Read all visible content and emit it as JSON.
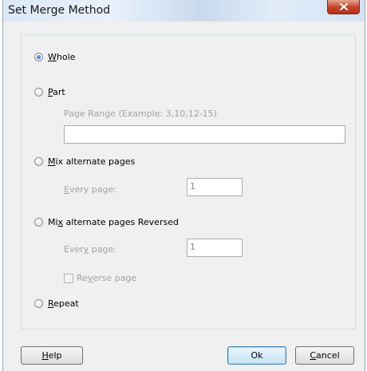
{
  "window": {
    "title": "Set Merge Method",
    "close_icon": "close-icon"
  },
  "options": {
    "whole": {
      "prefix": "",
      "accel": "W",
      "rest": "hole",
      "checked": true
    },
    "part": {
      "prefix": "",
      "accel": "P",
      "rest": "art",
      "checked": false,
      "range_label": "Page Range (Example: 3,10,12-15)",
      "range_value": ""
    },
    "mix": {
      "prefix": "",
      "accel": "M",
      "rest": "ix alternate pages",
      "checked": false,
      "every_prefix": "",
      "every_accel": "E",
      "every_rest": "very page:",
      "every_value": "1"
    },
    "mix_reversed": {
      "prefix": "Mi",
      "accel": "x",
      "rest": " alternate pages Reversed",
      "checked": false,
      "every_prefix": "Ever",
      "every_accel": "y",
      "every_rest": " page:",
      "every_value": "1",
      "reverse_prefix": "Re",
      "reverse_accel": "v",
      "reverse_rest": "erse page",
      "reverse_checked": false
    },
    "repeat": {
      "prefix": "",
      "accel": "R",
      "rest": "epeat",
      "checked": false
    }
  },
  "buttons": {
    "help": {
      "prefix": "",
      "accel": "H",
      "rest": "elp"
    },
    "ok": {
      "label": "Ok"
    },
    "cancel": {
      "prefix": "",
      "accel": "C",
      "rest": "ancel"
    }
  }
}
